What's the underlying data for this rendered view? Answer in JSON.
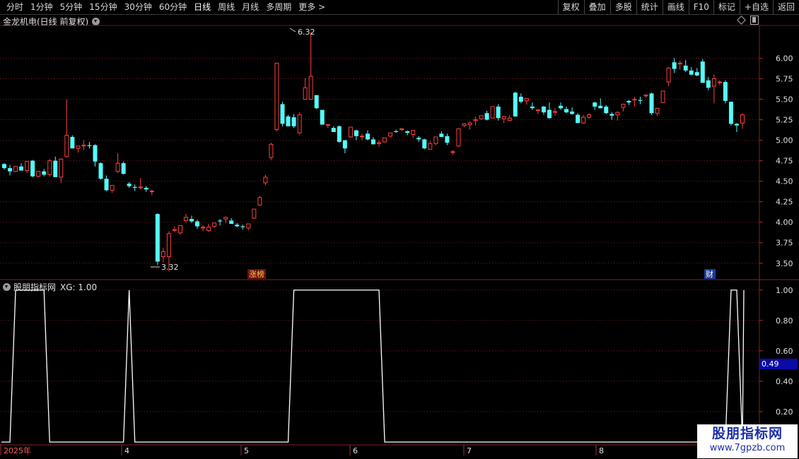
{
  "toolbar": {
    "periods": [
      "分时",
      "1分钟",
      "5分钟",
      "15分钟",
      "30分钟",
      "60分钟",
      "日线",
      "周线",
      "月线",
      "多周期",
      "更多 >"
    ],
    "active_period": "日线",
    "buttons": [
      "复权",
      "叠加",
      "多股",
      "统计",
      "画线",
      "F10",
      "标记",
      "+自选",
      "返回"
    ]
  },
  "stock": {
    "name": "金龙机电(日线 前复权)"
  },
  "price_chart": {
    "y_ticks": [
      "6.00",
      "5.75",
      "5.50",
      "5.25",
      "5.00",
      "4.75",
      "4.50",
      "4.25",
      "4.00",
      "3.75",
      "3.50"
    ],
    "y_tick_values": [
      6.0,
      5.75,
      5.5,
      5.25,
      5.0,
      4.75,
      4.5,
      4.25,
      4.0,
      3.75,
      3.5
    ],
    "high_label": "6.32",
    "low_label": "3.32",
    "markers": [
      {
        "text": "涨榜",
        "color": "#ffcc44"
      },
      {
        "text": "财",
        "color": "#ffffff"
      }
    ],
    "up_color": "#ff4040",
    "down_color": "#54fcfc"
  },
  "chart_data": {
    "type": "candlestick",
    "ohlc": [
      [
        4.71,
        4.72,
        4.64,
        4.66
      ],
      [
        4.66,
        4.7,
        4.57,
        4.62
      ],
      [
        4.62,
        4.68,
        4.61,
        4.68
      ],
      [
        4.68,
        4.72,
        4.65,
        4.63
      ],
      [
        4.63,
        4.75,
        4.6,
        4.74
      ],
      [
        4.75,
        4.76,
        4.55,
        4.56
      ],
      [
        4.56,
        4.62,
        4.55,
        4.62
      ],
      [
        4.62,
        4.65,
        4.56,
        4.58
      ],
      [
        4.58,
        4.77,
        4.56,
        4.75
      ],
      [
        4.75,
        4.8,
        4.65,
        4.55
      ],
      [
        4.55,
        4.78,
        4.48,
        4.77
      ],
      [
        4.8,
        5.5,
        4.79,
        5.06
      ],
      [
        5.04,
        5.06,
        4.9,
        4.9
      ],
      [
        4.9,
        4.92,
        4.85,
        4.93
      ],
      [
        4.93,
        5.0,
        4.88,
        4.94
      ],
      [
        4.94,
        4.98,
        4.9,
        4.93
      ],
      [
        4.94,
        4.95,
        4.68,
        4.74
      ],
      [
        4.72,
        4.73,
        4.52,
        4.53
      ],
      [
        4.53,
        4.57,
        4.38,
        4.39
      ],
      [
        4.39,
        4.45,
        4.36,
        4.45
      ],
      [
        4.62,
        4.84,
        4.6,
        4.72
      ],
      [
        4.72,
        4.74,
        4.58,
        4.59
      ],
      [
        4.47,
        4.49,
        4.42,
        4.44
      ],
      [
        4.43,
        4.46,
        4.38,
        4.42
      ],
      [
        4.42,
        4.54,
        4.4,
        4.43
      ],
      [
        4.42,
        4.44,
        4.37,
        4.4
      ],
      [
        4.38,
        4.4,
        4.33,
        4.38
      ],
      [
        4.1,
        4.11,
        3.48,
        3.52
      ],
      [
        3.58,
        3.69,
        3.51,
        3.64
      ],
      [
        3.58,
        3.89,
        3.4,
        3.86
      ],
      [
        3.9,
        3.95,
        3.88,
        3.91
      ],
      [
        3.87,
        3.95,
        3.85,
        3.96
      ],
      [
        4.02,
        4.1,
        4.0,
        4.06
      ],
      [
        4.04,
        4.08,
        3.99,
        4.01
      ],
      [
        4.01,
        4.03,
        3.92,
        3.95
      ],
      [
        3.93,
        3.96,
        3.89,
        3.94
      ],
      [
        3.9,
        3.98,
        3.88,
        3.94
      ],
      [
        3.95,
        3.99,
        3.93,
        3.99
      ],
      [
        4.02,
        4.04,
        3.96,
        4.01
      ],
      [
        4.04,
        4.07,
        3.99,
        4.06
      ],
      [
        4.02,
        4.05,
        3.99,
        3.98
      ],
      [
        3.97,
        3.99,
        3.94,
        3.95
      ],
      [
        3.95,
        3.97,
        3.91,
        3.94
      ],
      [
        3.93,
        3.95,
        3.9,
        3.98
      ],
      [
        4.05,
        4.16,
        4.04,
        4.16
      ],
      [
        4.21,
        4.32,
        4.2,
        4.3
      ],
      [
        4.48,
        4.58,
        4.45,
        4.55
      ],
      [
        4.79,
        4.97,
        4.76,
        4.95
      ],
      [
        5.13,
        5.93,
        5.11,
        5.94
      ],
      [
        5.44,
        5.47,
        5.17,
        5.2
      ],
      [
        5.29,
        5.31,
        5.18,
        5.17
      ],
      [
        5.28,
        5.32,
        5.15,
        5.17
      ],
      [
        5.09,
        5.34,
        5.07,
        5.31
      ],
      [
        5.5,
        5.76,
        5.49,
        5.64
      ],
      [
        5.5,
        6.32,
        5.49,
        5.78
      ],
      [
        5.55,
        5.55,
        5.38,
        5.39
      ],
      [
        5.37,
        5.37,
        5.19,
        5.19
      ],
      [
        5.18,
        5.2,
        5.15,
        5.19
      ],
      [
        5.15,
        5.17,
        5.1,
        5.1
      ],
      [
        5.17,
        5.18,
        4.97,
        4.98
      ],
      [
        5.0,
        5.0,
        4.84,
        4.9
      ],
      [
        5.04,
        5.16,
        5.03,
        5.16
      ],
      [
        5.12,
        5.13,
        5.0,
        5.05
      ],
      [
        5.05,
        5.08,
        5.0,
        5.05
      ],
      [
        5.08,
        5.12,
        5.0,
        5.01
      ],
      [
        5.01,
        5.04,
        4.95,
        4.95
      ],
      [
        4.96,
        5.0,
        4.92,
        4.97
      ],
      [
        4.98,
        5.02,
        4.97,
        5.03
      ],
      [
        5.05,
        5.08,
        5.03,
        5.09
      ],
      [
        5.11,
        5.13,
        5.09,
        5.1
      ],
      [
        5.13,
        5.15,
        5.11,
        5.14
      ],
      [
        5.11,
        5.12,
        5.06,
        5.09
      ],
      [
        5.07,
        5.1,
        5.03,
        5.12
      ],
      [
        5.03,
        5.05,
        4.98,
        5.01
      ],
      [
        5.01,
        5.02,
        4.89,
        4.9
      ],
      [
        4.89,
        4.99,
        4.89,
        4.96
      ],
      [
        4.96,
        5.04,
        4.94,
        5.04
      ],
      [
        5.08,
        5.11,
        5.06,
        5.04
      ],
      [
        5.05,
        5.08,
        4.94,
        4.97
      ],
      [
        4.86,
        4.88,
        4.82,
        4.86
      ],
      [
        4.93,
        5.1,
        4.92,
        5.14
      ],
      [
        5.18,
        5.21,
        5.16,
        5.2
      ],
      [
        5.19,
        5.23,
        5.13,
        5.21
      ],
      [
        5.24,
        5.29,
        5.18,
        5.25
      ],
      [
        5.26,
        5.29,
        5.25,
        5.3
      ],
      [
        5.33,
        5.36,
        5.24,
        5.25
      ],
      [
        5.27,
        5.38,
        5.27,
        5.41
      ],
      [
        5.41,
        5.44,
        5.24,
        5.27
      ],
      [
        5.26,
        5.28,
        5.21,
        5.29
      ],
      [
        5.24,
        5.31,
        5.23,
        5.27
      ],
      [
        5.58,
        5.59,
        5.29,
        5.29
      ],
      [
        5.53,
        5.57,
        5.45,
        5.47
      ],
      [
        5.48,
        5.49,
        5.43,
        5.51
      ],
      [
        5.41,
        5.46,
        5.37,
        5.39
      ],
      [
        5.36,
        5.38,
        5.32,
        5.37
      ],
      [
        5.41,
        5.42,
        5.31,
        5.34
      ],
      [
        5.37,
        5.46,
        5.26,
        5.27
      ],
      [
        5.34,
        5.39,
        5.3,
        5.35
      ],
      [
        5.42,
        5.46,
        5.37,
        5.39
      ],
      [
        5.38,
        5.41,
        5.33,
        5.34
      ],
      [
        5.35,
        5.4,
        5.31,
        5.32
      ],
      [
        5.31,
        5.33,
        5.21,
        5.21
      ],
      [
        5.21,
        5.31,
        5.2,
        5.28
      ],
      [
        5.28,
        5.33,
        5.26,
        5.31
      ],
      [
        5.46,
        5.47,
        5.37,
        5.41
      ],
      [
        5.42,
        5.51,
        5.39,
        5.39
      ],
      [
        5.41,
        5.43,
        5.32,
        5.33
      ],
      [
        5.32,
        5.34,
        5.25,
        5.3
      ],
      [
        5.31,
        5.35,
        5.24,
        5.34
      ],
      [
        5.4,
        5.42,
        5.35,
        5.44
      ],
      [
        5.48,
        5.49,
        5.43,
        5.46
      ],
      [
        5.49,
        5.53,
        5.41,
        5.5
      ],
      [
        5.49,
        5.53,
        5.44,
        5.48
      ],
      [
        5.54,
        5.56,
        5.52,
        5.55
      ],
      [
        5.57,
        5.58,
        5.31,
        5.33
      ],
      [
        5.33,
        5.37,
        5.3,
        5.39
      ],
      [
        5.46,
        5.58,
        5.45,
        5.6
      ],
      [
        5.71,
        5.89,
        5.66,
        5.88
      ],
      [
        5.95,
        6.0,
        5.82,
        5.87
      ],
      [
        5.93,
        5.97,
        5.86,
        5.94
      ],
      [
        5.91,
        5.98,
        5.83,
        5.85
      ],
      [
        5.85,
        5.89,
        5.79,
        5.8
      ],
      [
        5.83,
        5.88,
        5.78,
        5.79
      ],
      [
        5.96,
        5.99,
        5.7,
        5.7
      ],
      [
        5.73,
        5.77,
        5.61,
        5.64
      ],
      [
        5.66,
        5.8,
        5.45,
        5.75
      ],
      [
        5.71,
        5.73,
        5.67,
        5.71
      ],
      [
        5.71,
        5.73,
        5.45,
        5.48
      ],
      [
        5.47,
        5.47,
        5.18,
        5.2
      ],
      [
        5.2,
        5.21,
        5.1,
        5.18
      ],
      [
        5.21,
        5.33,
        5.14,
        5.31
      ]
    ],
    "ylim": [
      3.3,
      6.4
    ],
    "x_ticks": [
      "2025年",
      "4",
      "5",
      "6",
      "7",
      "8"
    ],
    "indicator": {
      "name": "股朋指标网",
      "label": "XG: 1.00",
      "y_ticks": [
        "1.00",
        "0.80",
        "0.60",
        "0.40",
        "0.20"
      ],
      "y_tick_values": [
        1.0,
        0.8,
        0.6,
        0.4,
        0.2
      ],
      "ylim": [
        0,
        1.05
      ],
      "current_readout": "0.49",
      "high_segments": [
        [
          2,
          7
        ],
        [
          22,
          22
        ],
        [
          51,
          66
        ],
        [
          128,
          129
        ]
      ]
    }
  },
  "watermark": {
    "line1": "股朋指标网",
    "line2": "www.7gpzb.com"
  }
}
